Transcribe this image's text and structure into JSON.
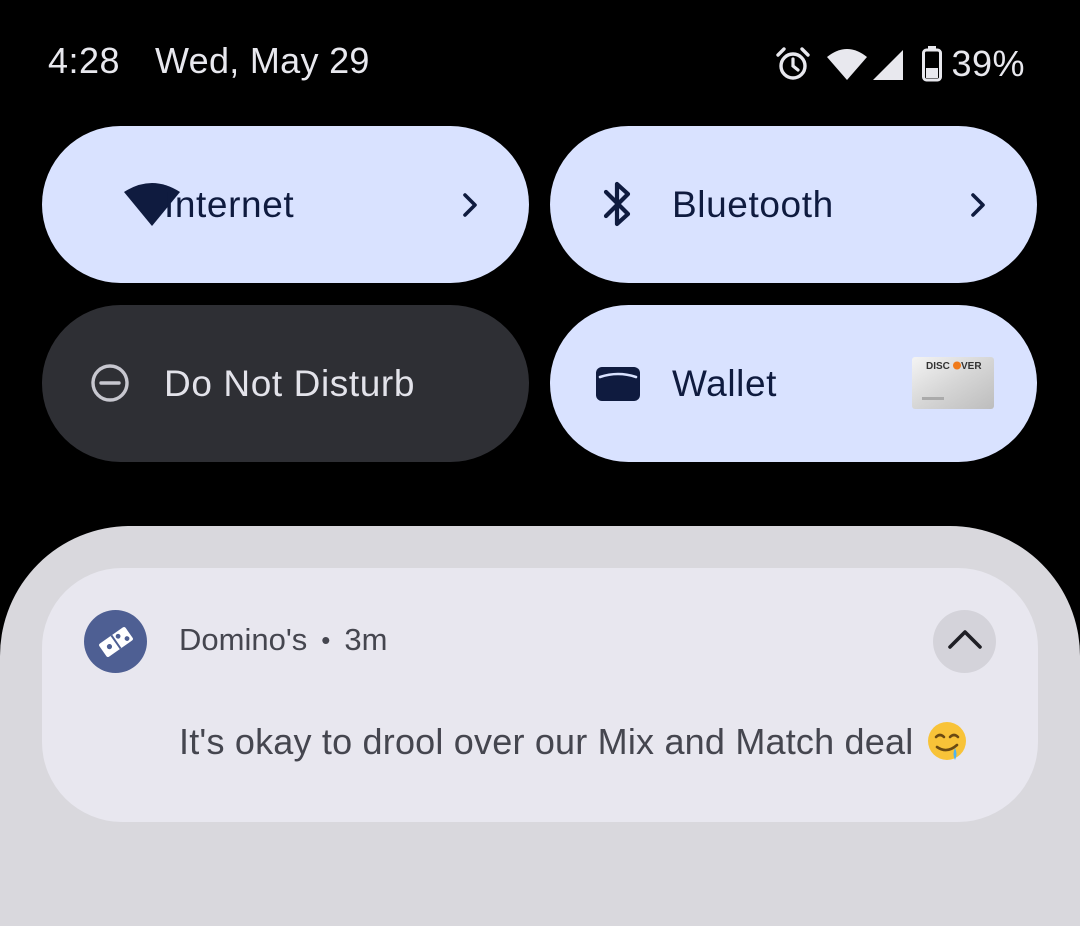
{
  "status_bar": {
    "time": "4:28",
    "date": "Wed, May 29",
    "battery_percent": "39%",
    "icons": [
      "alarm-icon",
      "wifi-icon",
      "signal-icon",
      "battery-icon"
    ]
  },
  "quick_settings": {
    "tiles": [
      {
        "label": "Internet",
        "icon": "wifi-icon",
        "state": "on",
        "has_chevron": true
      },
      {
        "label": "Bluetooth",
        "icon": "bluetooth-icon",
        "state": "on",
        "has_chevron": true
      },
      {
        "label": "Do Not Disturb",
        "icon": "do-not-disturb-icon",
        "state": "off",
        "has_chevron": false
      },
      {
        "label": "Wallet",
        "icon": "wallet-icon",
        "state": "on",
        "card_brand": "DISCOVER"
      }
    ]
  },
  "notification": {
    "app_name": "Domino's",
    "separator": "•",
    "time_ago": "3m",
    "message": "It's okay to drool over our Mix and Match deal",
    "emoji": "drooling-face-emoji",
    "app_icon": "dominos-logo-icon",
    "expand_icon": "chevron-up-icon"
  },
  "colors": {
    "background": "#000000",
    "tile_active": "#d9e2ff",
    "tile_inactive": "#2e2f34",
    "shade": "#d9d8dd",
    "card": "#e8e7ef",
    "app_icon_bg": "#4e5f93"
  }
}
